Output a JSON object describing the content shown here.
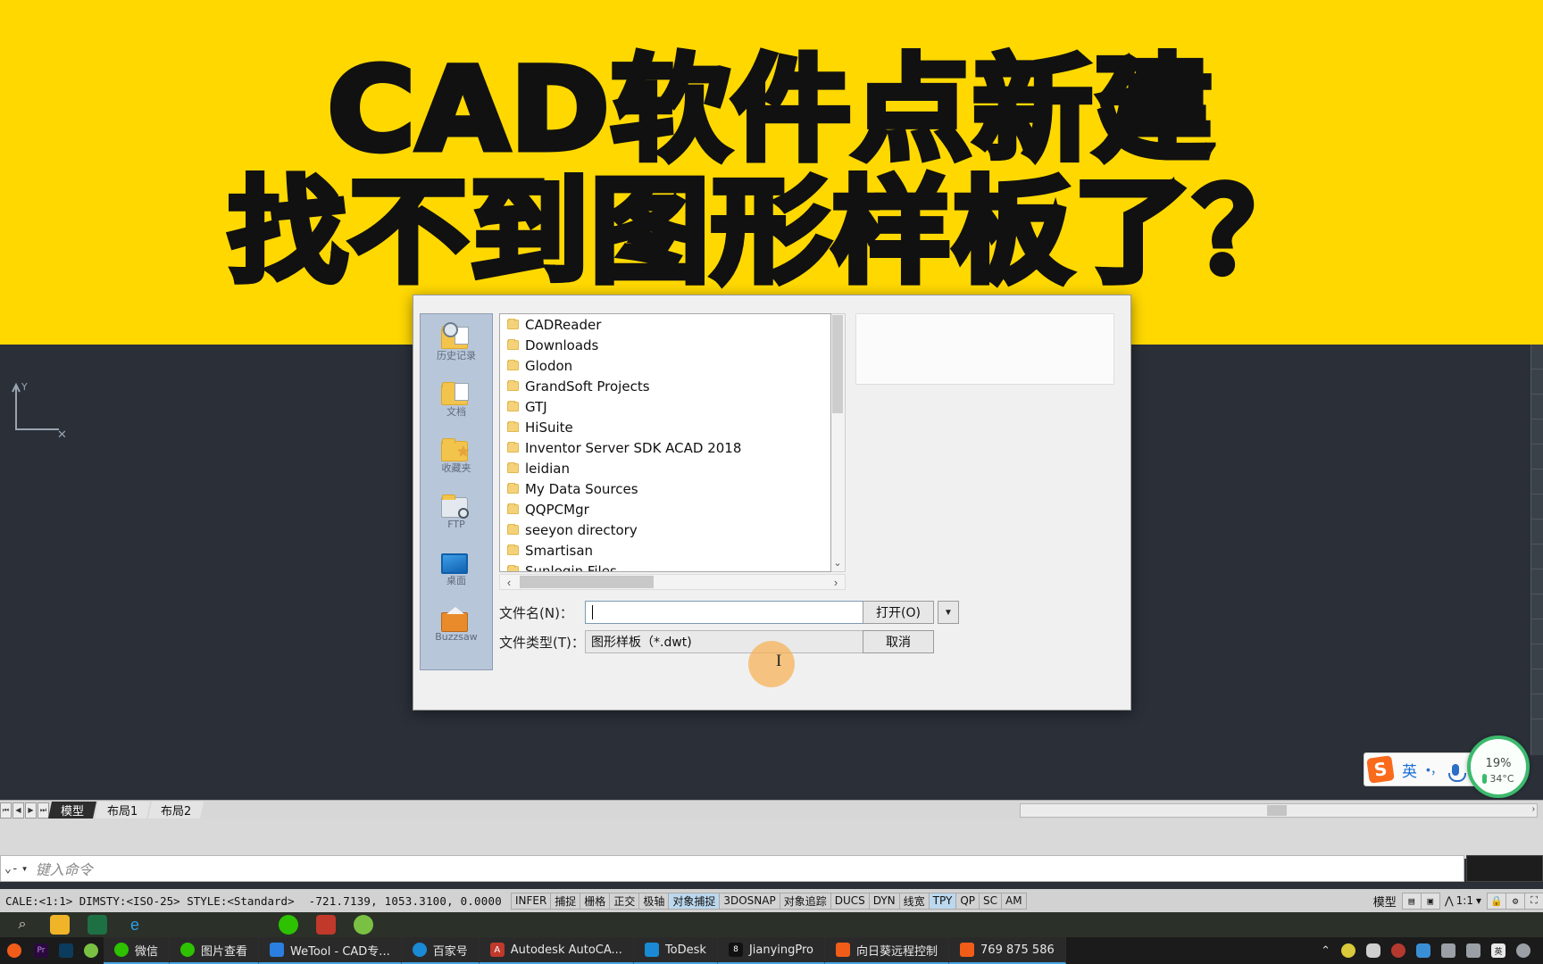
{
  "banner": {
    "line1": "CAD软件点新建",
    "line2": "找不到图形样板了？"
  },
  "dialog": {
    "places": [
      {
        "label": "历史记录",
        "icon": "history-icon"
      },
      {
        "label": "文档",
        "icon": "documents-folder-icon"
      },
      {
        "label": "收藏夹",
        "icon": "favorites-folder-icon"
      },
      {
        "label": "FTP",
        "icon": "ftp-icon"
      },
      {
        "label": "桌面",
        "icon": "desktop-icon"
      },
      {
        "label": "Buzzsaw",
        "icon": "buzzsaw-icon"
      }
    ],
    "files": [
      "CADReader",
      "Downloads",
      "Glodon",
      "GrandSoft Projects",
      "GTJ",
      "HiSuite",
      "Inventor Server SDK ACAD 2018",
      "leidian",
      "My Data Sources",
      "QQPCMgr",
      "seeyon directory",
      "Smartisan",
      "Sunlogin Files"
    ],
    "filename_label": "文件名(N)：",
    "filename_value": "",
    "filetype_label": "文件类型(T)：",
    "filetype_value": "图形样板（*.dwt)",
    "open_button": "打开(O)",
    "cancel_button": "取消",
    "open_dropdown": "▼",
    "scroll_left": "‹",
    "scroll_right": "›",
    "scroll_down": "⌄"
  },
  "ime": {
    "logo": "S",
    "language_mode": "英",
    "punctuation": "•，",
    "mic": "mic-icon",
    "battery_percent": "19",
    "battery_percent_unit": "%",
    "temperature": "34°C"
  },
  "layout_tabs": {
    "nav": [
      "⏮",
      "◀",
      "▶",
      "⏭"
    ],
    "tabs": [
      {
        "label": "模型",
        "active": true
      },
      {
        "label": "布局1",
        "active": false
      },
      {
        "label": "布局2",
        "active": false
      }
    ]
  },
  "command": {
    "prompt": "⌄-",
    "placeholder": "键入命令"
  },
  "status": {
    "sysvars": "CALE:<1:1>  DIMSTY:<ISO-25>  STYLE:<Standard>",
    "coordinates": "-721.7139,  1053.3100,  0.0000",
    "toggles": [
      {
        "label": "INFER",
        "on": false
      },
      {
        "label": "捕捉",
        "on": false
      },
      {
        "label": "栅格",
        "on": false
      },
      {
        "label": "正交",
        "on": false
      },
      {
        "label": "极轴",
        "on": false
      },
      {
        "label": "对象捕捉",
        "on": true
      },
      {
        "label": "3DOSNAP",
        "on": false
      },
      {
        "label": "对象追踪",
        "on": false
      },
      {
        "label": "DUCS",
        "on": false
      },
      {
        "label": "DYN",
        "on": false
      },
      {
        "label": "线宽",
        "on": false
      },
      {
        "label": "TPY",
        "on": true
      },
      {
        "label": "QP",
        "on": false
      },
      {
        "label": "SC",
        "on": false
      },
      {
        "label": "AM",
        "on": false
      }
    ],
    "model_label": "模型",
    "scale": "1:1"
  },
  "taskbar": {
    "quick_icons": [
      {
        "name": "search-icon",
        "color": "#cfcfcf"
      },
      {
        "name": "file-explorer-icon",
        "color": "#f0b429"
      },
      {
        "name": "excel-icon",
        "color": "#1d7044"
      },
      {
        "name": "internet-explorer-icon",
        "color": "#1a8ad4"
      },
      {
        "name": "wechat-icon",
        "color": "#2dc100"
      },
      {
        "name": "autocad-icon",
        "color": "#c0392b"
      },
      {
        "name": "browser-icon",
        "color": "#7ac143"
      }
    ],
    "apps": [
      {
        "label": "微信",
        "icon_color": "#2dc100",
        "active": true
      },
      {
        "label": "图片查看",
        "icon_color": "#2dc100",
        "active": true
      },
      {
        "label": "WeTool - CAD专...",
        "icon_color": "#2a7fe0",
        "active": true
      },
      {
        "label": "百家号",
        "icon_color": "#1a8ad4",
        "active": true
      },
      {
        "label": "Autodesk AutoCA...",
        "icon_color": "#c0392b",
        "active": true
      },
      {
        "label": "ToDesk",
        "icon_color": "#1a8ad4",
        "active": true
      },
      {
        "label": "JianyingPro",
        "icon_color": "#111111",
        "active": true
      },
      {
        "label": "向日葵远程控制",
        "icon_color": "#f25c19",
        "active": true
      },
      {
        "label": "769 875 586",
        "icon_color": "#f25c19",
        "active": true
      }
    ],
    "left_small_icons": [
      {
        "name": "premiere-icon",
        "color": "#2a0a3d"
      },
      {
        "name": "photoshop-icon",
        "color": "#0b3c5d"
      },
      {
        "name": "browser-small-icon",
        "color": "#7ac143"
      }
    ],
    "tray": [
      {
        "name": "show-hidden-icons-chevron",
        "color": "transparent"
      },
      {
        "name": "update-icon",
        "color": "#d9c93b"
      },
      {
        "name": "microphone-icon",
        "color": "#cfcfcf"
      },
      {
        "name": "antivirus-icon",
        "color": "#b5392f"
      },
      {
        "name": "cloud-icon",
        "color": "#3a8fd4"
      },
      {
        "name": "network-icon",
        "color": "#cfcfcf"
      },
      {
        "name": "volume-icon",
        "color": "#cfcfcf"
      },
      {
        "name": "ime-tray-icon",
        "color": "#e8e8e8"
      },
      {
        "name": "clock-icon",
        "color": "#cfcfcf"
      }
    ]
  },
  "colors": {
    "banner_yellow": "#FFD800",
    "cad_canvas": "#2a2f38",
    "dialog_bg": "#f0f0f0",
    "places_bg": "#b8c6d9",
    "accent_blue": "#bcd8ee",
    "battery_green": "#3cba6d"
  }
}
